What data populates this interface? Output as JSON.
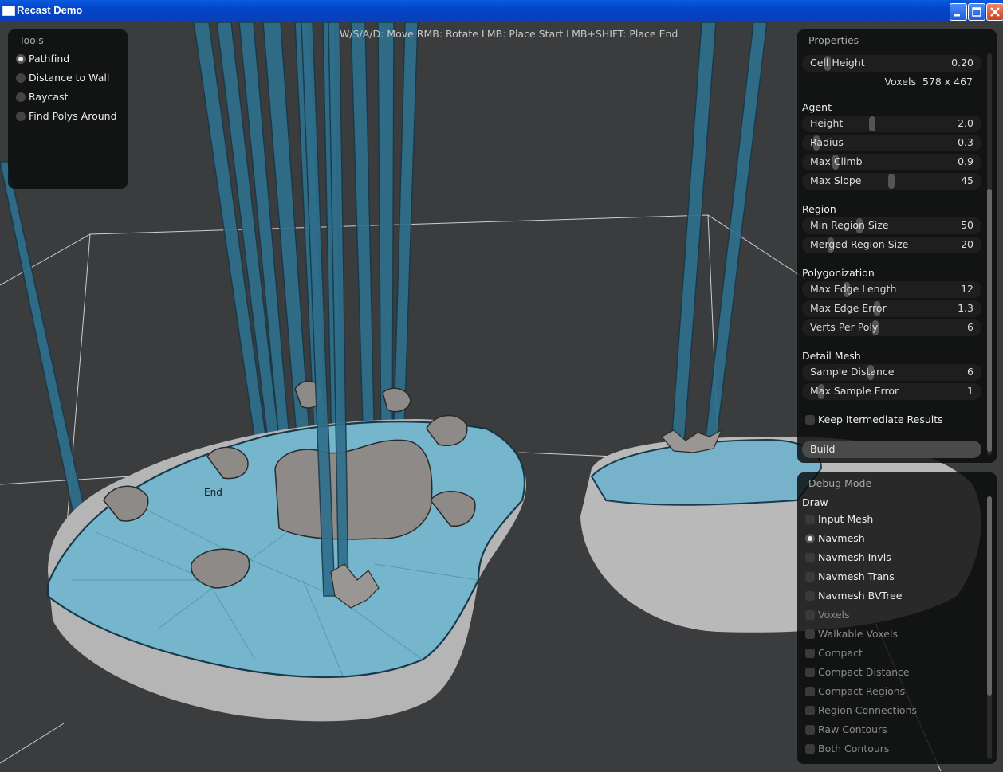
{
  "window": {
    "title": "Recast Demo"
  },
  "hint": "W/S/A/D: Move  RMB: Rotate   LMB: Place Start   LMB+SHIFT: Place End",
  "scene": {
    "end_marker": "End"
  },
  "tools": {
    "title": "Tools",
    "items": [
      {
        "label": "Pathfind",
        "selected": true
      },
      {
        "label": "Distance to Wall",
        "selected": false
      },
      {
        "label": "Raycast",
        "selected": false
      },
      {
        "label": "Find Polys Around",
        "selected": false
      }
    ]
  },
  "properties": {
    "title": "Properties",
    "cell_height": {
      "label": "Cell Height",
      "value": "0.20",
      "level": 0.1
    },
    "voxels": {
      "label": "Voxels",
      "value": "578 x 467"
    },
    "agent": {
      "heading": "Agent",
      "height": {
        "label": "Height",
        "value": "2.0",
        "level": 0.38
      },
      "radius": {
        "label": "Radius",
        "value": "0.3",
        "level": 0.03
      },
      "max_climb": {
        "label": "Max Climb",
        "value": "0.9",
        "level": 0.15
      },
      "max_slope": {
        "label": "Max Slope",
        "value": "45",
        "level": 0.5
      }
    },
    "region": {
      "heading": "Region",
      "min_region_size": {
        "label": "Min Region Size",
        "value": "50",
        "level": 0.3
      },
      "merged_region_size": {
        "label": "Merged Region Size",
        "value": "20",
        "level": 0.12
      }
    },
    "polygonization": {
      "heading": "Polygonization",
      "max_edge_length": {
        "label": "Max Edge Length",
        "value": "12",
        "level": 0.22
      },
      "max_edge_error": {
        "label": "Max Edge Error",
        "value": "1.3",
        "level": 0.41
      },
      "verts_per_poly": {
        "label": "Verts Per Poly",
        "value": "6",
        "level": 0.4
      }
    },
    "detail_mesh": {
      "heading": "Detail Mesh",
      "sample_distance": {
        "label": "Sample Distance",
        "value": "6",
        "level": 0.37
      },
      "max_sample_error": {
        "label": "Max Sample Error",
        "value": "1",
        "level": 0.06
      }
    },
    "keep_intermediate": {
      "label": "Keep Itermediate Results",
      "checked": false
    },
    "build_label": "Build"
  },
  "debug": {
    "title": "Debug Mode",
    "draw_heading": "Draw",
    "items": [
      {
        "label": "Input Mesh",
        "selected": false,
        "enabled": true
      },
      {
        "label": "Navmesh",
        "selected": true,
        "enabled": true
      },
      {
        "label": "Navmesh Invis",
        "selected": false,
        "enabled": true
      },
      {
        "label": "Navmesh Trans",
        "selected": false,
        "enabled": true
      },
      {
        "label": "Navmesh BVTree",
        "selected": false,
        "enabled": true
      },
      {
        "label": "Voxels",
        "selected": false,
        "enabled": false
      },
      {
        "label": "Walkable Voxels",
        "selected": false,
        "enabled": false
      },
      {
        "label": "Compact",
        "selected": false,
        "enabled": false
      },
      {
        "label": "Compact Distance",
        "selected": false,
        "enabled": false
      },
      {
        "label": "Compact Regions",
        "selected": false,
        "enabled": false
      },
      {
        "label": "Region Connections",
        "selected": false,
        "enabled": false
      },
      {
        "label": "Raw Contours",
        "selected": false,
        "enabled": false
      },
      {
        "label": "Both Contours",
        "selected": false,
        "enabled": false
      }
    ]
  },
  "colors": {
    "navmesh": "#6fb6d0",
    "pillar": "#2f6f8c",
    "terrain": "#b7b7b7",
    "panel": "#0a0a0a"
  }
}
